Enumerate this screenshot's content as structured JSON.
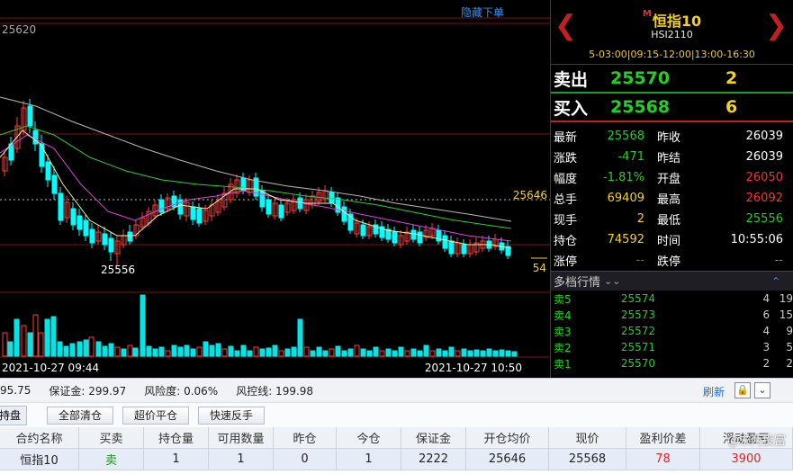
{
  "chart": {
    "hide_order_label": "隐藏下单",
    "top_price_label": "25620",
    "current_price_tag": "25646",
    "low_price_label": "25556",
    "small_value_tag": "54",
    "start_time": "2021-10-27 09:44",
    "end_time": "2021-10-27 10:50"
  },
  "instrument": {
    "marker": "M",
    "name": "恒指10",
    "code": "HSI2110",
    "hours": "5-03:00|09:15-12:00|13:00-16:30"
  },
  "quotes": {
    "sell_label": "卖出",
    "sell_price": "25570",
    "sell_vol": "2",
    "buy_label": "买入",
    "buy_price": "25568",
    "buy_vol": "6"
  },
  "stats": [
    {
      "k1": "最新",
      "v1": "25568",
      "c1": "#22d022",
      "k2": "昨收",
      "v2": "26039",
      "c2": "#ffffff"
    },
    {
      "k1": "涨跌",
      "v1": "-471",
      "c1": "#22d022",
      "k2": "昨结",
      "v2": "26039",
      "c2": "#ffffff"
    },
    {
      "k1": "幅度",
      "v1": "-1.81%",
      "c1": "#22d022",
      "k2": "开盘",
      "v2": "26050",
      "c2": "#ff3030"
    },
    {
      "k1": "总手",
      "v1": "69409",
      "c1": "#f2d21f",
      "k2": "最高",
      "v2": "26092",
      "c2": "#ff3030"
    },
    {
      "k1": "现手",
      "v1": "2",
      "c1": "#f2d21f",
      "k2": "最低",
      "v2": "25556",
      "c2": "#22d022"
    },
    {
      "k1": "持仓",
      "v1": "74592",
      "c1": "#f2d21f",
      "k2": "时间",
      "v2": "10:55:06",
      "c2": "#ffffff"
    },
    {
      "k1": "涨停",
      "v1": "--",
      "c1": "#ff3030",
      "k2": "跌停",
      "v2": "--",
      "c2": "#22d022"
    }
  ],
  "depth": {
    "title": "多档行情",
    "rows": [
      {
        "label": "卖5",
        "price": "25574",
        "vol": "4",
        "num": "19"
      },
      {
        "label": "卖4",
        "price": "25573",
        "vol": "6",
        "num": "15"
      },
      {
        "label": "卖3",
        "price": "25572",
        "vol": "4",
        "num": "9"
      },
      {
        "label": "卖2",
        "price": "25571",
        "vol": "3",
        "num": "5"
      },
      {
        "label": "卖1",
        "price": "25570",
        "vol": "2",
        "num": "2"
      }
    ]
  },
  "status": {
    "first": "95.75",
    "margin": "保证金: 299.97",
    "risk": "风险度: 0.06%",
    "risk_line": "风控线: 199.98",
    "refresh": "刷新"
  },
  "toolbar": {
    "tab": "持盘",
    "close_all": "全部清仓",
    "over_price_close": "超价平仓",
    "quick_reverse": "快速反手"
  },
  "table": {
    "headers": [
      "合约名称",
      "买卖",
      "持仓量",
      "可用数量",
      "昨仓",
      "今仓",
      "保证金",
      "开仓均价",
      "现价",
      "盈利价差",
      "浮动盈亏"
    ],
    "row": [
      "恒指10",
      "卖",
      "1",
      "1",
      "0",
      "1",
      "2222",
      "25646",
      "25568",
      "78",
      "3900"
    ]
  },
  "watermark": "@末两投富"
}
